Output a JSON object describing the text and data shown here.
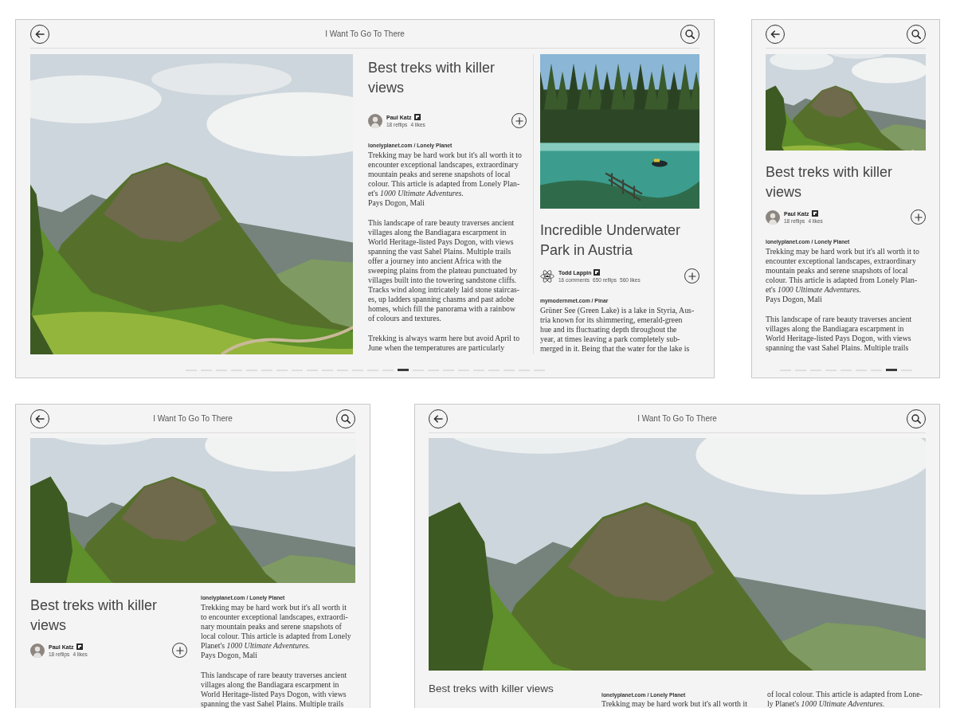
{
  "views": [
    {
      "kind": "spread",
      "title": "I Want To Go To There",
      "articles": [
        {
          "image": {
            "kind": "mountain"
          },
          "title_lines": [
            "Best treks with killer",
            "views"
          ],
          "author": {
            "name": "Paul Katz",
            "avatar": {
              "kind": "person"
            }
          },
          "stats": [
            "18 reflips",
            "4 likes"
          ],
          "source": "lonelyplanet.com / Lonely Planet",
          "paragraphs": [
            [
              "Trekking may be hard work but it's all worth it to",
              "encounter exceptional landscapes, extraordinary",
              "mountain peaks and serene snapshots of local",
              "colour. This article is adapted from Lonely Plan-",
              "et's *1000 Ultimate Adventures.*",
              "Pays Dogon, Mali"
            ],
            [
              "This landscape of rare beauty traverses ancient",
              "villages along the Bandiagara escarpment in",
              "World Heritage-listed Pays Dogon, with views",
              "spanning the vast Sahel Plains. Multiple trails",
              "offer a journey into ancient Africa with the",
              "sweeping plains from the plateau punctuated by",
              "villages built into the towering sandstone cliffs.",
              "Tracks wind along intricately laid stone staircas-",
              "es, up ladders spanning chasms and past adobe",
              "homes, which fill the panorama with a rainbow",
              "of colours and textures."
            ],
            [
              "Trekking is always warm here but avoid April to",
              "June when the temperatures are particularly"
            ]
          ]
        },
        {
          "image": {
            "kind": "lake"
          },
          "title_lines": [
            "Incredible Underwater",
            "Park in Austria"
          ],
          "author": {
            "name": "Todd Lappin",
            "avatar": {
              "kind": "atom"
            }
          },
          "stats": [
            "16 comments",
            "650 reflips",
            "560 likes"
          ],
          "source": "mymodernmet.com / Pinar",
          "paragraphs": [
            [
              "Grüner See (Green Lake) is a lake in Styria, Aus-",
              "tria known for its shimmering, emerald-green",
              "hue and its fluctuating depth throughout the",
              "year, at times leaving a park completely sub-",
              "merged in it. Being that the water for the lake is"
            ]
          ]
        }
      ],
      "pages": [
        {
          "selected": false
        },
        {
          "selected": false
        },
        {
          "selected": false
        },
        {
          "selected": false
        },
        {
          "selected": false
        },
        {
          "selected": false
        },
        {
          "selected": false
        },
        {
          "selected": false
        },
        {
          "selected": false
        },
        {
          "selected": false
        },
        {
          "selected": false
        },
        {
          "selected": false
        },
        {
          "selected": false
        },
        {
          "selected": false
        },
        {
          "selected": true
        },
        {
          "selected": false
        },
        {
          "selected": false
        },
        {
          "selected": false
        },
        {
          "selected": false
        },
        {
          "selected": false
        },
        {
          "selected": false
        },
        {
          "selected": false
        },
        {
          "selected": false
        },
        {
          "selected": false
        }
      ]
    },
    {
      "kind": "narrow",
      "articles": [
        {
          "image": {
            "kind": "mountain"
          },
          "title_lines": [
            "Best treks with killer",
            "views"
          ],
          "author": {
            "name": "Paul Katz",
            "avatar": {
              "kind": "person"
            }
          },
          "stats": [
            "18 reflips",
            "4 likes"
          ],
          "source": "lonelyplanet.com / Lonely Planet",
          "paragraphs": [
            [
              "Trekking may be hard work but it's all worth it to",
              "encounter exceptional landscapes, extraordinary",
              "mountain peaks and serene snapshots of local",
              "colour. This article is adapted from Lonely Plan-",
              "et's *1000 Ultimate Adventures.*",
              "Pays Dogon, Mali"
            ],
            [
              "This landscape of rare beauty traverses ancient",
              "villages along the Bandiagara escarpment in",
              "World Heritage-listed Pays Dogon, with views",
              "spanning the vast Sahel Plains. Multiple trails"
            ]
          ]
        }
      ],
      "pages": [
        {
          "selected": false
        },
        {
          "selected": false
        },
        {
          "selected": false
        },
        {
          "selected": false
        },
        {
          "selected": false
        },
        {
          "selected": false
        },
        {
          "selected": false
        },
        {
          "selected": true
        },
        {
          "selected": false
        }
      ]
    },
    {
      "kind": "stacked",
      "title": "I Want To Go To There",
      "articles": [
        {
          "image": {
            "kind": "mountain"
          },
          "title_lines": [
            "Best treks with killer",
            "views"
          ],
          "author": {
            "name": "Paul Katz",
            "avatar": {
              "kind": "person"
            }
          },
          "stats": [
            "18 reflips",
            "4 likes"
          ],
          "source": "lonelyplanet.com / Lonely Planet",
          "paragraphs": [
            [
              "Trekking may be hard work but it's all worth it",
              "to encounter exceptional landscapes, extraordi-",
              "nary mountain peaks and serene snapshots of",
              "local colour. This article is adapted from Lonely",
              "Planet's *1000 Ultimate Adventures.*",
              "Pays Dogon, Mali"
            ],
            [
              "This landscape of rare beauty traverses ancient",
              "villages along the Bandiagara escarpment in",
              "World Heritage-listed Pays Dogon, with views",
              "spanning the vast Sahel Plains. Multiple trails"
            ]
          ]
        }
      ]
    },
    {
      "kind": "hero",
      "title": "I Want To Go To There",
      "articles": [
        {
          "image": {
            "kind": "mountain"
          },
          "title_lines": [
            "Best treks with killer views"
          ],
          "source": "lonelyplanet.com / Lonely Planet",
          "columns": [
            [
              "Trekking may be hard work but it's all worth it"
            ],
            [
              "of local colour. This article is adapted from Lone-",
              "ly Planet's *1000 Ultimate Adventures.*"
            ]
          ]
        }
      ]
    }
  ]
}
